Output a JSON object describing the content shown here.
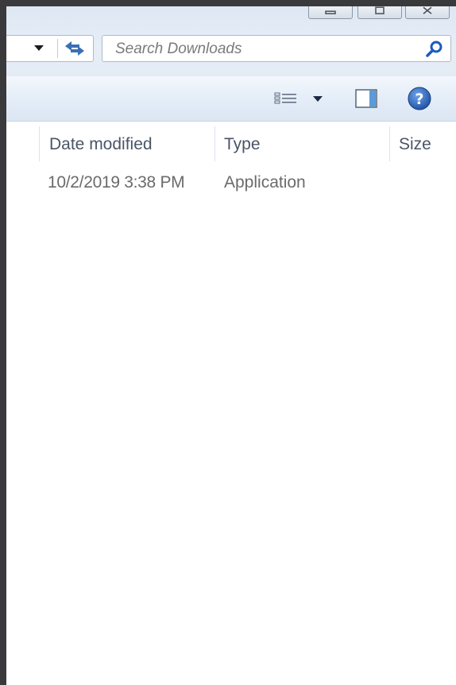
{
  "search": {
    "placeholder": "Search Downloads",
    "value": ""
  },
  "columns": {
    "date_modified": "Date modified",
    "type": "Type",
    "size": "Size"
  },
  "files": [
    {
      "date_modified": "10/2/2019 3:38 PM",
      "type": "Application",
      "size": ""
    }
  ],
  "colors": {
    "accent": "#1e5bb8",
    "header_text": "#4a5566",
    "cell_text": "#6b6b6b"
  },
  "icons": {
    "address_dropdown": "chevron-down-icon",
    "refresh": "refresh-icon",
    "search": "search-icon",
    "view": "details-view-icon",
    "preview": "preview-pane-icon",
    "help": "help-icon"
  }
}
